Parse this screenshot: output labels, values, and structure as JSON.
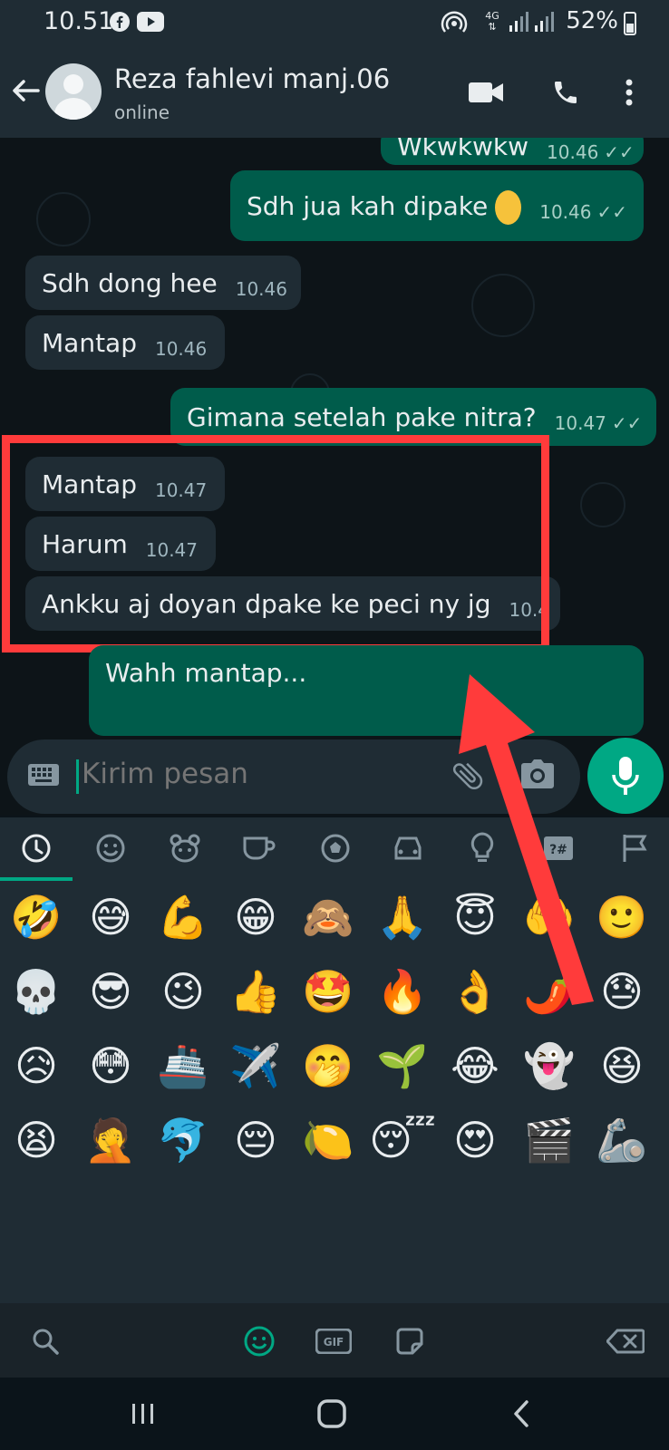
{
  "status_bar": {
    "time": "10.51",
    "battery": "52%",
    "network": "4G"
  },
  "header": {
    "contact_name": "Reza fahlevi manj.06",
    "status": "online"
  },
  "messages": [
    {
      "dir": "out",
      "text": "Wkwkwkw",
      "time": "10.46"
    },
    {
      "dir": "out",
      "text": "Sdh jua kah dipake",
      "time": "10.46",
      "emoji": "rolling-on-floor-laughing"
    },
    {
      "dir": "in",
      "text": "Sdh dong hee",
      "time": "10.46"
    },
    {
      "dir": "in",
      "text": "Mantap",
      "time": "10.46"
    },
    {
      "dir": "out",
      "text": "Gimana setelah pake nitra?",
      "time": "10.47"
    },
    {
      "dir": "in",
      "text": "Mantap",
      "time": "10.47"
    },
    {
      "dir": "in",
      "text": "Harum",
      "time": "10.47"
    },
    {
      "dir": "in",
      "text": "Ankku aj doyan dpake ke peci ny jg",
      "time": "10.4"
    },
    {
      "dir": "out",
      "text": "Wahh mantap...",
      "time": ""
    }
  ],
  "composer": {
    "placeholder": "Kirim pesan"
  },
  "emoji_categories": [
    "recent-icon",
    "smileys-icon",
    "animals-icon",
    "food-icon",
    "activity-icon",
    "travel-icon",
    "objects-icon",
    "symbols-icon",
    "flags-icon"
  ],
  "emoji_rows": [
    [
      "🤣",
      "😅",
      "💪",
      "😁",
      "🙈",
      "🙏",
      "😇",
      "🤲",
      "🙂"
    ],
    [
      "💀",
      "😎",
      "😉",
      "👍",
      "🤩",
      "🔥",
      "👌",
      "🌶️",
      "😓"
    ],
    [
      "😥",
      "😳",
      "🚢",
      "✈️",
      "🤭",
      "🌱",
      "😂",
      "👻",
      "😆"
    ],
    [
      "😫",
      "🤦",
      "🐬",
      "😔",
      "🍋",
      "😴",
      "😍",
      "🎬",
      "🦾"
    ]
  ],
  "colors": {
    "accent": "#00a884",
    "outgoing": "#005c4b",
    "incoming": "#1f2c34",
    "highlight": "#ff3b3b"
  }
}
